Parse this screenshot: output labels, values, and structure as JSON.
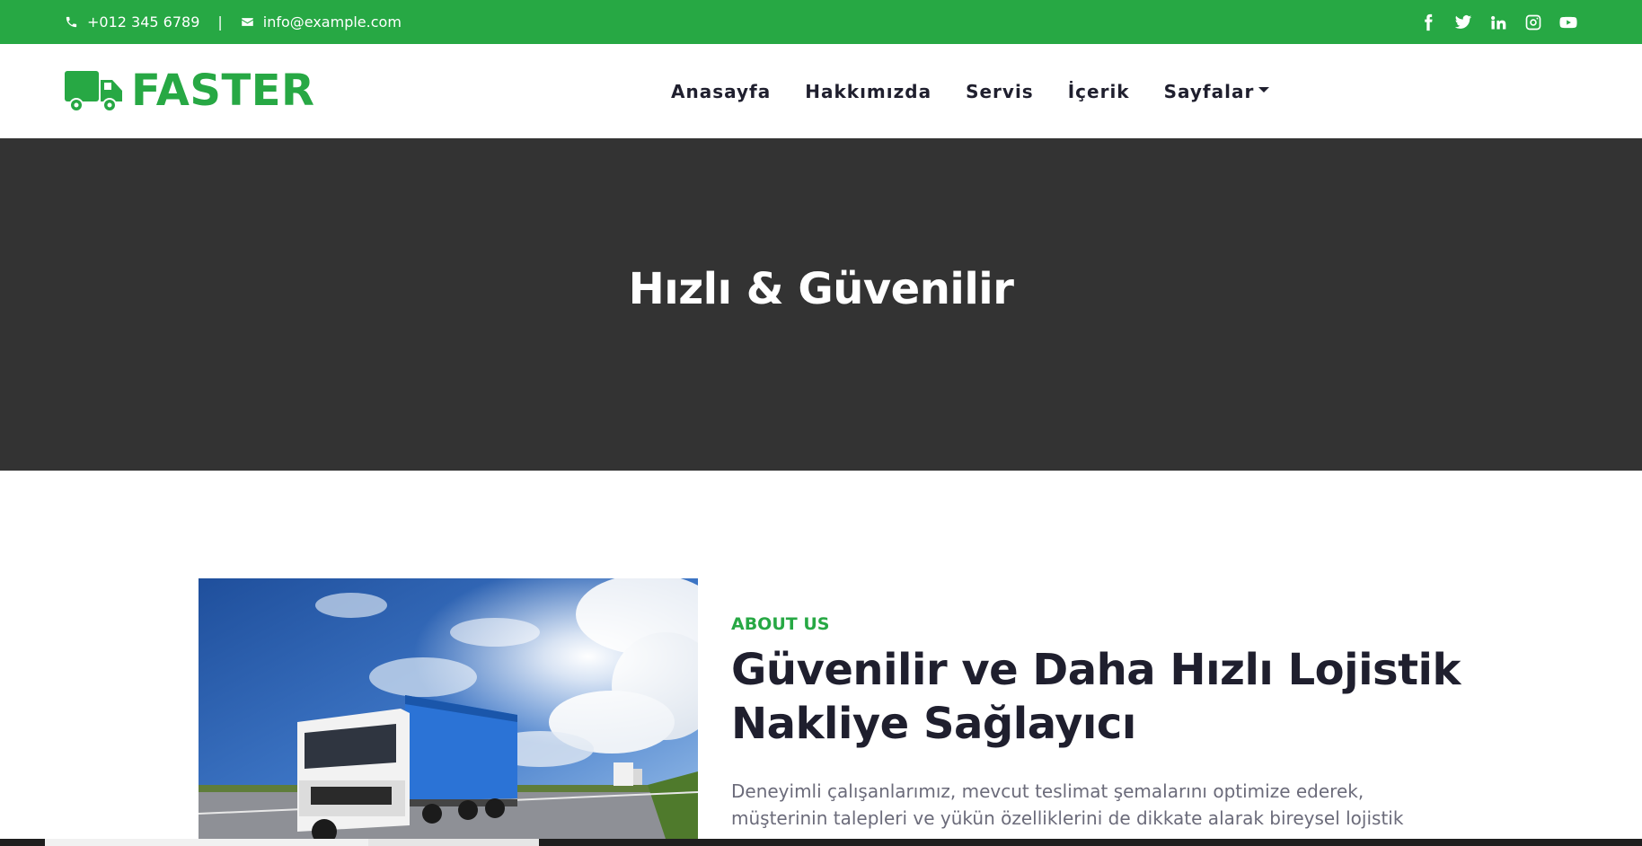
{
  "topbar": {
    "phone": "+012 345 6789",
    "separator": "|",
    "email": "info@example.com",
    "social": [
      "facebook-icon",
      "twitter-icon",
      "linkedin-icon",
      "instagram-icon",
      "youtube-icon"
    ]
  },
  "brand": {
    "name": "FASTER",
    "icon": "truck-icon"
  },
  "nav": {
    "items": [
      "Anasayfa",
      "Hakkımızda",
      "Servis",
      "İçerik",
      "Sayfalar"
    ]
  },
  "hero": {
    "title": "Hızlı & Güvenilir"
  },
  "about": {
    "subtitle": "ABOUT US",
    "title": "Güvenilir ve Daha Hızlı Lojistik Nakliye Sağlayıcı",
    "text": "Deneyimli çalışanlarımız, mevcut teslimat şemalarını optimize ederek, müşterinin talepleri ve yükün özelliklerini de dikkate alarak bireysel lojistik"
  },
  "colors": {
    "primary": "#27a844",
    "dark": "#333333",
    "text": "#1f1f2e"
  }
}
